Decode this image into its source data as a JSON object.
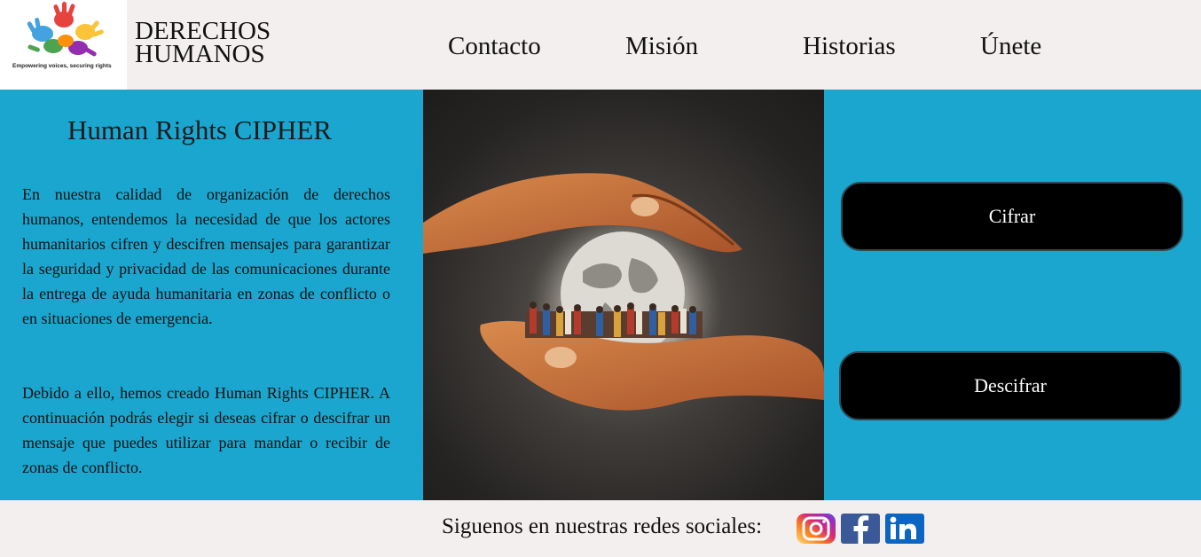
{
  "header": {
    "logo_tagline": "Empowering voices, securing rights",
    "brand_line1": "DERECHOS",
    "brand_line2": "HUMANOS",
    "nav": [
      {
        "label": "Contacto"
      },
      {
        "label": "Misión"
      },
      {
        "label": "Historias"
      },
      {
        "label": "Únete"
      }
    ]
  },
  "intro": {
    "title": "Human Rights CIPHER",
    "paragraph1": "En nuestra calidad de organización de derechos humanos, entendemos la necesidad de que los actores humanitarios cifren y descifren mensajes para garantizar la seguridad y privacidad de las comunicaciones durante la entrega de ayuda humanitaria en zonas de conflicto o en situaciones de emergencia.",
    "paragraph2": "Debido a ello, hemos creado Human Rights CIPHER. A continuación podrás elegir si deseas cifrar o descifrar un mensaje que puedes utilizar para mandar o recibir de zonas de conflicto."
  },
  "actions": {
    "encrypt_label": "Cifrar",
    "decrypt_label": "Descifrar"
  },
  "footer": {
    "social_text": "Siguenos en nuestras redes sociales:",
    "icons": [
      "instagram-icon",
      "facebook-icon",
      "linkedin-icon"
    ]
  },
  "colors": {
    "main_background": "#1ba6cf",
    "page_background": "#f3efee",
    "button_background": "#000000",
    "button_text": "#ffffff",
    "facebook": "#3b5998",
    "linkedin": "#0a66c2"
  }
}
